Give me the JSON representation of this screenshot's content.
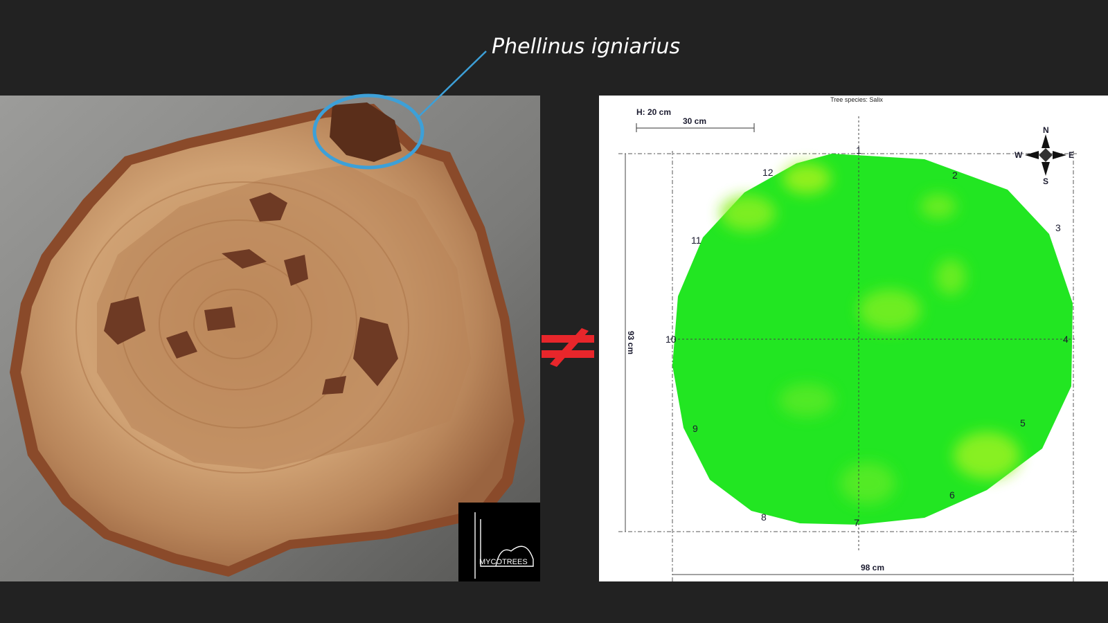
{
  "caption": "Phellinus igniarius",
  "watermark": {
    "text": "MYCOTREES"
  },
  "tomogram": {
    "species_label": "Tree species: Salix",
    "height_label": "H: 20 cm",
    "scale_label": "30 cm",
    "vertical_dim": "93 cm",
    "horizontal_dim": "98 cm",
    "compass": {
      "n": "N",
      "s": "S",
      "e": "E",
      "w": "W"
    },
    "sensors": [
      "1",
      "2",
      "3",
      "4",
      "5",
      "6",
      "7",
      "8",
      "9",
      "10",
      "11",
      "12"
    ]
  },
  "symbol": {
    "name": "not-equal-icon",
    "color": "#e8262b"
  },
  "colors": {
    "background": "#222222",
    "highlight": "#3da0d8",
    "healthy_wood": "#22e622",
    "photo_backdrop": "#8c8c8a"
  }
}
